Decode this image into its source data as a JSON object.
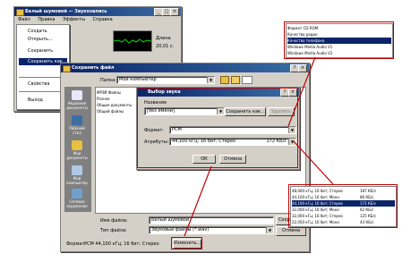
{
  "main_window": {
    "title": "Белый шумовой — Звукозапись",
    "menu": [
      "Файл",
      "Правка",
      "Эффекты",
      "Справка"
    ],
    "file_menu": [
      "Создать",
      "Открыть...",
      "Сохранить",
      "Сохранить как...",
      "Свойства",
      "Выход"
    ],
    "position_label": "Длина",
    "position_value": "20,01 с."
  },
  "save_dialog": {
    "title": "Сохранить файл",
    "folder_label": "Папка:",
    "folder_value": "Мой компьютер",
    "places": [
      "Недавние документы",
      "Рабочий стол",
      "Мои документы",
      "Мой компьютер",
      "Сетевое окружение"
    ],
    "files": [
      "МРЗЙ Файлы",
      "Разное",
      "Общие документы",
      "Общий файлы"
    ],
    "filename_label": "Имя файла:",
    "filename_value": "Белый шумовой",
    "filetype_label": "Тип файла:",
    "filetype_value": "Звуковые файлы (*.wav)",
    "save_button": "Сохранить",
    "cancel_button": "Отмена",
    "format_label": "Формат:",
    "format_value": "PCM 44,100 кГц; 16 бит; Стерео",
    "change_button": "Изменить..."
  },
  "sound_dialog": {
    "title": "Выбор звука",
    "name_label": "Название",
    "name_value": "[без имени]",
    "save_as_button": "Сохранить как...",
    "remove_button": "Удалить",
    "format_label": "Формат:",
    "format_value": "PCM",
    "attributes_label": "Атрибуты:",
    "attributes_value": "44,100 кГц; 16 бит; Стерео",
    "attributes_rate": "172 КБ/с",
    "ok_button": "ОК",
    "cancel_button": "Отмена"
  },
  "format_popup": {
    "items": [
      "Формат CD-ROM",
      "Качество радио",
      "Качество телефона",
      "Windows Media Audio V1",
      "Windows Media Audio V2"
    ],
    "selected_index": 2
  },
  "attributes_popup": {
    "items": [
      {
        "label": "48,000 кГц; 16 бит; Стерео",
        "rate": "187 КБ/с"
      },
      {
        "label": "44,100 кГц; 16 бит; Моно",
        "rate": "86 КБ/с"
      },
      {
        "label": "44,100 кГц; 16 бит; Стерео",
        "rate": "172 КБ/с"
      },
      {
        "label": "32,000 кГц; 16 бит; Моно",
        "rate": "62 КБ/с"
      },
      {
        "label": "32,000 кГц; 16 бит; Стерео",
        "rate": "125 КБ/с"
      },
      {
        "label": "22,050 кГц; 16 бит; Моно",
        "rate": "43 КБ/с"
      }
    ],
    "selected_index": 2
  },
  "colors": {
    "title_bar": "#0a246a",
    "dialog_face": "#d4d0c8",
    "selection": "#0a246a",
    "highlight": "#c00000",
    "wave": "#00e000"
  },
  "icons": {
    "folder": "folder-icon",
    "up": "up-folder-icon",
    "new_folder": "new-folder-icon",
    "views": "view-menu-icon",
    "close": "close-icon",
    "help": "help-icon"
  }
}
